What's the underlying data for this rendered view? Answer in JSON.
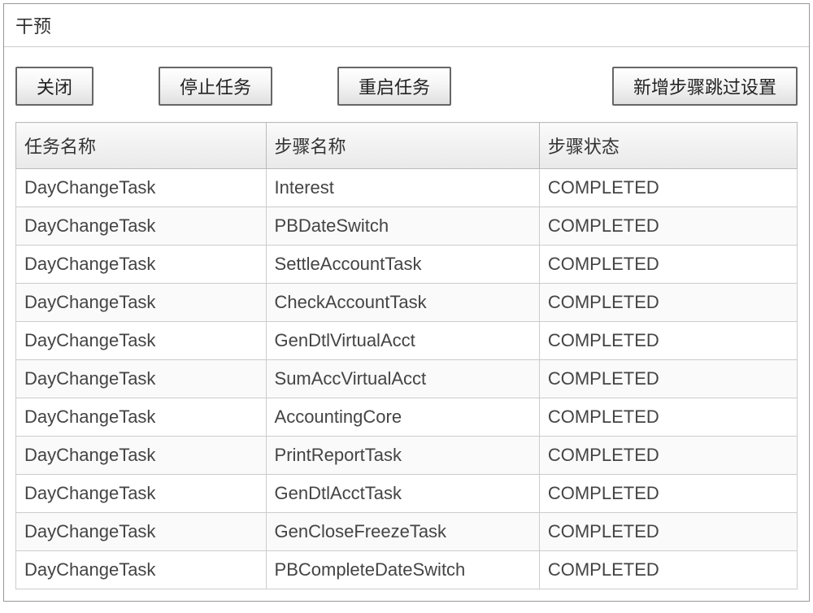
{
  "window": {
    "title": "干预"
  },
  "toolbar": {
    "close_label": "关闭",
    "stop_label": "停止任务",
    "restart_label": "重启任务",
    "add_skip_label": "新增步骤跳过设置"
  },
  "table": {
    "headers": {
      "task_name": "任务名称",
      "step_name": "步骤名称",
      "step_status": "步骤状态"
    },
    "rows": [
      {
        "task": "DayChangeTask",
        "step": "Interest",
        "status": "COMPLETED"
      },
      {
        "task": "DayChangeTask",
        "step": "PBDateSwitch",
        "status": "COMPLETED"
      },
      {
        "task": "DayChangeTask",
        "step": "SettleAccountTask",
        "status": "COMPLETED"
      },
      {
        "task": "DayChangeTask",
        "step": "CheckAccountTask",
        "status": "COMPLETED"
      },
      {
        "task": "DayChangeTask",
        "step": "GenDtlVirtualAcct",
        "status": "COMPLETED"
      },
      {
        "task": "DayChangeTask",
        "step": "SumAccVirtualAcct",
        "status": "COMPLETED"
      },
      {
        "task": "DayChangeTask",
        "step": "AccountingCore",
        "status": "COMPLETED"
      },
      {
        "task": "DayChangeTask",
        "step": "PrintReportTask",
        "status": "COMPLETED"
      },
      {
        "task": "DayChangeTask",
        "step": "GenDtlAcctTask",
        "status": "COMPLETED"
      },
      {
        "task": "DayChangeTask",
        "step": "GenCloseFreezeTask",
        "status": "COMPLETED"
      },
      {
        "task": "DayChangeTask",
        "step": "PBCompleteDateSwitch",
        "status": "COMPLETED"
      }
    ]
  }
}
